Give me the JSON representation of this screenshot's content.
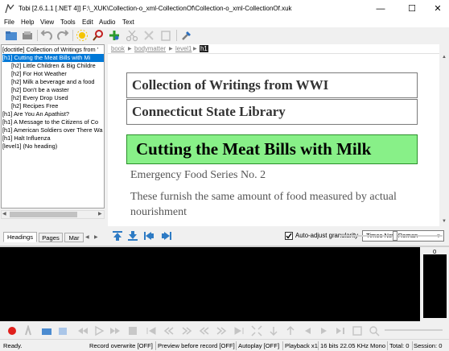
{
  "window": {
    "title": "Tobi [2.6.1.1 [.NET 4]]  F:\\_XUK\\Collection-o_xml-CollectionOf\\Collection-o_xml-CollectionOf.xuk",
    "minimize": "—",
    "maximize": "☐",
    "close": "✕"
  },
  "menu": [
    "File",
    "Help",
    "View",
    "Tools",
    "Edit",
    "Audio",
    "Text"
  ],
  "tree": {
    "items": [
      {
        "label": "[doctitle] Collection of Writings from '"
      },
      {
        "label": "[h1]  Cutting the Meat Bills with Mi"
      },
      {
        "label": "[h2]  Little Children & Big Childre"
      },
      {
        "label": "[h2]  For Hot Weather"
      },
      {
        "label": "[h2]  Milk a beverage and a food"
      },
      {
        "label": "[h2]  Don't be a waster"
      },
      {
        "label": "[h2]  Every Drop Used"
      },
      {
        "label": "[h2]  Recipes Free"
      },
      {
        "label": "[h1]  Are You An Apathist?"
      },
      {
        "label": "[h1]  A Message to the Citizens of Co"
      },
      {
        "label": "[h1]  American Soldiers over There Wa"
      },
      {
        "label": "[h1]  Halt Influenza"
      },
      {
        "label": "[level1] (No heading)"
      }
    ],
    "selected_index": 1
  },
  "tabs": [
    "Headings",
    "Pages",
    "Mar"
  ],
  "breadcrumb": [
    "book",
    "bodymatter",
    "level1",
    "h1"
  ],
  "document": {
    "title_line1": "Collection of Writings from WWI",
    "title_line2": "Connecticut State Library",
    "heading": "Cutting the Meat Bills with Milk",
    "subheading": "Emergency Food Series No. 2",
    "paragraph": "These furnish the same amount of food measured by actual nourishment"
  },
  "audio_controls": {
    "autoadjust_label": "Auto-adjust granularity",
    "autoadjust_checked": true,
    "font_value": "Times New Roman"
  },
  "meter": {
    "label": "0"
  },
  "status": {
    "ready": "Ready.",
    "record_overwrite": "Record overwrite [OFF]",
    "preview": "Preview before record [OFF]",
    "autoplay": "Autoplay [OFF]",
    "playback": "Playback x1",
    "format": "16 bits 22.05 KHz Mono",
    "total": "Total: 0",
    "session": "Session: 0"
  },
  "colors": {
    "accent": "#0078d7",
    "heading_bg": "#88f088",
    "heading_border": "#2a8f2a",
    "record": "#e0201c",
    "media_blue": "#2e7bc4"
  }
}
